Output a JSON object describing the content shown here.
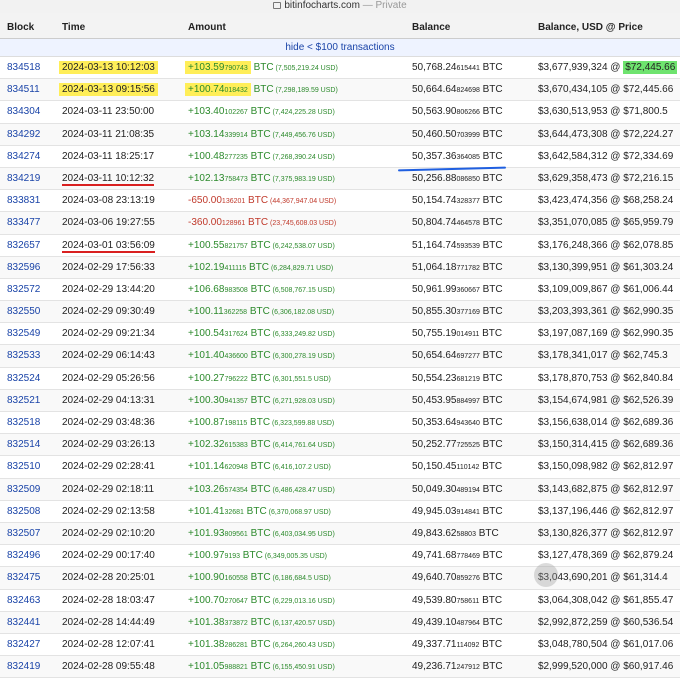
{
  "browser": {
    "domain": "bitinfocharts.com",
    "mode": "— Private"
  },
  "columns": {
    "block": "Block",
    "time": "Time",
    "amount": "Amount",
    "balance": "Balance",
    "usd": "Balance, USD @ Price"
  },
  "filter_link": "hide < $100 transactions",
  "rows": [
    {
      "block": "834518",
      "time": "2024-03-13 10:12:03",
      "amt_main": "+103.59",
      "amt_small": "790743",
      "amt_unit": " BTC",
      "amt_usd": " (7,505,219.24 USD)",
      "bal_main": "50,768.24",
      "bal_small": "615441",
      "bal_unit": " BTC",
      "usd": "$3,677,939,324 @ ",
      "price": "$72,445.66",
      "sign": "pos",
      "time_hl": "yellow",
      "amt_hl": "yellow",
      "price_hl": "green"
    },
    {
      "block": "834511",
      "time": "2024-03-13 09:15:56",
      "amt_main": "+100.74",
      "amt_small": "018432",
      "amt_unit": " BTC",
      "amt_usd": " (7,298,189.59 USD)",
      "bal_main": "50,664.64",
      "bal_small": "824698",
      "bal_unit": " BTC",
      "usd": "$3,670,434,105 @ ",
      "price": "$72,445.66",
      "sign": "pos",
      "time_hl": "yellow",
      "amt_hl": "yellow"
    },
    {
      "block": "834304",
      "time": "2024-03-11 23:50:00",
      "amt_main": "+103.40",
      "amt_small": "102267",
      "amt_unit": " BTC",
      "amt_usd": " (7,424,225.28 USD)",
      "bal_main": "50,563.90",
      "bal_small": "806266",
      "bal_unit": " BTC",
      "usd": "$3,630,513,953 @ ",
      "price": "$71,800.5",
      "sign": "pos"
    },
    {
      "block": "834292",
      "time": "2024-03-11 21:08:35",
      "amt_main": "+103.14",
      "amt_small": "339914",
      "amt_unit": " BTC",
      "amt_usd": " (7,449,456.76 USD)",
      "bal_main": "50,460.50",
      "bal_small": "703999",
      "bal_unit": " BTC",
      "usd": "$3,644,473,308 @ ",
      "price": "$72,224.27",
      "sign": "pos"
    },
    {
      "block": "834274",
      "time": "2024-03-11 18:25:17",
      "amt_main": "+100.48",
      "amt_small": "277235",
      "amt_unit": " BTC",
      "amt_usd": " (7,268,390.24 USD)",
      "bal_main": "50,357.36",
      "bal_small": "364085",
      "bal_unit": " BTC",
      "usd": "$3,642,584,312 @ ",
      "price": "$72,334.69",
      "sign": "pos"
    },
    {
      "block": "834219",
      "time": "2024-03-11 10:12:32",
      "amt_main": "+102.13",
      "amt_small": "758473",
      "amt_unit": " BTC",
      "amt_usd": " (7,375,983.19 USD)",
      "bal_main": "50,256.88",
      "bal_small": "086850",
      "bal_unit": " BTC",
      "usd": "$3,629,358,473 @ ",
      "price": "$72,216.15",
      "sign": "pos",
      "time_hl": "red"
    },
    {
      "block": "833831",
      "time": "2024-03-08 23:13:19",
      "amt_main": "-650.00",
      "amt_small": "136201",
      "amt_unit": " BTC",
      "amt_usd": " (44,367,947.04 USD)",
      "bal_main": "50,154.74",
      "bal_small": "328377",
      "bal_unit": " BTC",
      "usd": "$3,423,474,356 @ ",
      "price": "$68,258.24",
      "sign": "neg"
    },
    {
      "block": "833477",
      "time": "2024-03-06 19:27:55",
      "amt_main": "-360.00",
      "amt_small": "128961",
      "amt_unit": " BTC",
      "amt_usd": " (23,745,608.03 USD)",
      "bal_main": "50,804.74",
      "bal_small": "464578",
      "bal_unit": " BTC",
      "usd": "$3,351,070,085 @ ",
      "price": "$65,959.79",
      "sign": "neg"
    },
    {
      "block": "832657",
      "time": "2024-03-01 03:56:09",
      "amt_main": "+100.55",
      "amt_small": "821757",
      "amt_unit": " BTC",
      "amt_usd": " (6,242,538.07 USD)",
      "bal_main": "51,164.74",
      "bal_small": "593539",
      "bal_unit": " BTC",
      "usd": "$3,176,248,366 @ ",
      "price": "$62,078.85",
      "sign": "pos",
      "time_hl": "red"
    },
    {
      "block": "832596",
      "time": "2024-02-29 17:56:33",
      "amt_main": "+102.19",
      "amt_small": "411115",
      "amt_unit": " BTC",
      "amt_usd": " (6,284,829.71 USD)",
      "bal_main": "51,064.18",
      "bal_small": "771782",
      "bal_unit": " BTC",
      "usd": "$3,130,399,951 @ ",
      "price": "$61,303.24",
      "sign": "pos"
    },
    {
      "block": "832572",
      "time": "2024-02-29 13:44:20",
      "amt_main": "+106.68",
      "amt_small": "983508",
      "amt_unit": " BTC",
      "amt_usd": " (6,508,767.15 USD)",
      "bal_main": "50,961.99",
      "bal_small": "360667",
      "bal_unit": " BTC",
      "usd": "$3,109,009,867 @ ",
      "price": "$61,006.44",
      "sign": "pos"
    },
    {
      "block": "832550",
      "time": "2024-02-29 09:30:49",
      "amt_main": "+100.11",
      "amt_small": "362258",
      "amt_unit": " BTC",
      "amt_usd": " (6,306,182.08 USD)",
      "bal_main": "50,855.30",
      "bal_small": "377169",
      "bal_unit": " BTC",
      "usd": "$3,203,393,361 @ ",
      "price": "$62,990.35",
      "sign": "pos"
    },
    {
      "block": "832549",
      "time": "2024-02-29 09:21:34",
      "amt_main": "+100.54",
      "amt_small": "317624",
      "amt_unit": " BTC",
      "amt_usd": " (6,333,249.82 USD)",
      "bal_main": "50,755.19",
      "bal_small": "014911",
      "bal_unit": " BTC",
      "usd": "$3,197,087,169 @ ",
      "price": "$62,990.35",
      "sign": "pos"
    },
    {
      "block": "832533",
      "time": "2024-02-29 06:14:43",
      "amt_main": "+101.40",
      "amt_small": "436600",
      "amt_unit": " BTC",
      "amt_usd": " (6,300,278.19 USD)",
      "bal_main": "50,654.64",
      "bal_small": "697277",
      "bal_unit": " BTC",
      "usd": "$3,178,341,017 @ ",
      "price": "$62,745.3",
      "sign": "pos"
    },
    {
      "block": "832524",
      "time": "2024-02-29 05:26:56",
      "amt_main": "+100.27",
      "amt_small": "796222",
      "amt_unit": " BTC",
      "amt_usd": " (6,301,551.5 USD)",
      "bal_main": "50,554.23",
      "bal_small": "681219",
      "bal_unit": " BTC",
      "usd": "$3,178,870,753 @ ",
      "price": "$62,840.84",
      "sign": "pos"
    },
    {
      "block": "832521",
      "time": "2024-02-29 04:13:31",
      "amt_main": "+100.30",
      "amt_small": "941357",
      "amt_unit": " BTC",
      "amt_usd": " (6,271,928.03 USD)",
      "bal_main": "50,453.95",
      "bal_small": "884997",
      "bal_unit": " BTC",
      "usd": "$3,154,674,981 @ ",
      "price": "$62,526.39",
      "sign": "pos"
    },
    {
      "block": "832518",
      "time": "2024-02-29 03:48:36",
      "amt_main": "+100.87",
      "amt_small": "198115",
      "amt_unit": " BTC",
      "amt_usd": " (6,323,599.88 USD)",
      "bal_main": "50,353.64",
      "bal_small": "943640",
      "bal_unit": " BTC",
      "usd": "$3,156,638,014 @ ",
      "price": "$62,689.36",
      "sign": "pos"
    },
    {
      "block": "832514",
      "time": "2024-02-29 03:26:13",
      "amt_main": "+102.32",
      "amt_small": "615383",
      "amt_unit": " BTC",
      "amt_usd": " (6,414,761.64 USD)",
      "bal_main": "50,252.77",
      "bal_small": "725525",
      "bal_unit": " BTC",
      "usd": "$3,150,314,415 @ ",
      "price": "$62,689.36",
      "sign": "pos"
    },
    {
      "block": "832510",
      "time": "2024-02-29 02:28:41",
      "amt_main": "+101.14",
      "amt_small": "620948",
      "amt_unit": " BTC",
      "amt_usd": " (6,416,107.2 USD)",
      "bal_main": "50,150.45",
      "bal_small": "110142",
      "bal_unit": " BTC",
      "usd": "$3,150,098,982 @ ",
      "price": "$62,812.97",
      "sign": "pos"
    },
    {
      "block": "832509",
      "time": "2024-02-29 02:18:11",
      "amt_main": "+103.26",
      "amt_small": "574354",
      "amt_unit": " BTC",
      "amt_usd": " (6,486,428.47 USD)",
      "bal_main": "50,049.30",
      "bal_small": "489194",
      "bal_unit": " BTC",
      "usd": "$3,143,682,875 @ ",
      "price": "$62,812.97",
      "sign": "pos"
    },
    {
      "block": "832508",
      "time": "2024-02-29 02:13:58",
      "amt_main": "+101.41",
      "amt_small": "32681",
      "amt_unit": " BTC",
      "amt_usd": " (6,370,068.97 USD)",
      "bal_main": "49,945.03",
      "bal_small": "914841",
      "bal_unit": " BTC",
      "usd": "$3,137,196,446 @ ",
      "price": "$62,812.97",
      "sign": "pos"
    },
    {
      "block": "832507",
      "time": "2024-02-29 02:10:20",
      "amt_main": "+101.93",
      "amt_small": "809561",
      "amt_unit": " BTC",
      "amt_usd": " (6,403,034.95 USD)",
      "bal_main": "49,843.62",
      "bal_small": "58803",
      "bal_unit": " BTC",
      "usd": "$3,130,826,377 @ ",
      "price": "$62,812.97",
      "sign": "pos"
    },
    {
      "block": "832496",
      "time": "2024-02-29 00:17:40",
      "amt_main": "+100.97",
      "amt_small": "9193",
      "amt_unit": " BTC",
      "amt_usd": " (6,349,005.35 USD)",
      "bal_main": "49,741.68",
      "bal_small": "778469",
      "bal_unit": " BTC",
      "usd": "$3,127,478,369 @ ",
      "price": "$62,879.24",
      "sign": "pos"
    },
    {
      "block": "832475",
      "time": "2024-02-28 20:25:01",
      "amt_main": "+100.90",
      "amt_small": "160558",
      "amt_unit": " BTC",
      "amt_usd": " (6,186,684.5 USD)",
      "bal_main": "49,640.70",
      "bal_small": "859276",
      "bal_unit": " BTC",
      "usd": "$3,043,690,201 @ ",
      "price": "$61,314.4",
      "sign": "pos"
    },
    {
      "block": "832463",
      "time": "2024-02-28 18:03:47",
      "amt_main": "+100.70",
      "amt_small": "270647",
      "amt_unit": " BTC",
      "amt_usd": " (6,229,013.16 USD)",
      "bal_main": "49,539.80",
      "bal_small": "758611",
      "bal_unit": " BTC",
      "usd": "$3,064,308,042 @ ",
      "price": "$61,855.47",
      "sign": "pos"
    },
    {
      "block": "832441",
      "time": "2024-02-28 14:44:49",
      "amt_main": "+101.38",
      "amt_small": "373872",
      "amt_unit": " BTC",
      "amt_usd": " (6,137,420.57 USD)",
      "bal_main": "49,439.10",
      "bal_small": "487964",
      "bal_unit": " BTC",
      "usd": "$2,992,872,259 @ ",
      "price": "$60,536.54",
      "sign": "pos"
    },
    {
      "block": "832427",
      "time": "2024-02-28 12:07:41",
      "amt_main": "+101.38",
      "amt_small": "286281",
      "amt_unit": " BTC",
      "amt_usd": " (6,264,260.43 USD)",
      "bal_main": "49,337.71",
      "bal_small": "114092",
      "bal_unit": " BTC",
      "usd": "$3,048,780,504 @ ",
      "price": "$61,017.06",
      "sign": "pos"
    },
    {
      "block": "832419",
      "time": "2024-02-28 09:55:48",
      "amt_main": "+101.05",
      "amt_small": "988821",
      "amt_unit": " BTC",
      "amt_usd": " (6,155,450.91 USD)",
      "bal_main": "49,236.71",
      "bal_small": "247912",
      "bal_unit": " BTC",
      "usd": "$2,999,520,000 @ ",
      "price": "$60,917.46",
      "sign": "pos"
    }
  ]
}
